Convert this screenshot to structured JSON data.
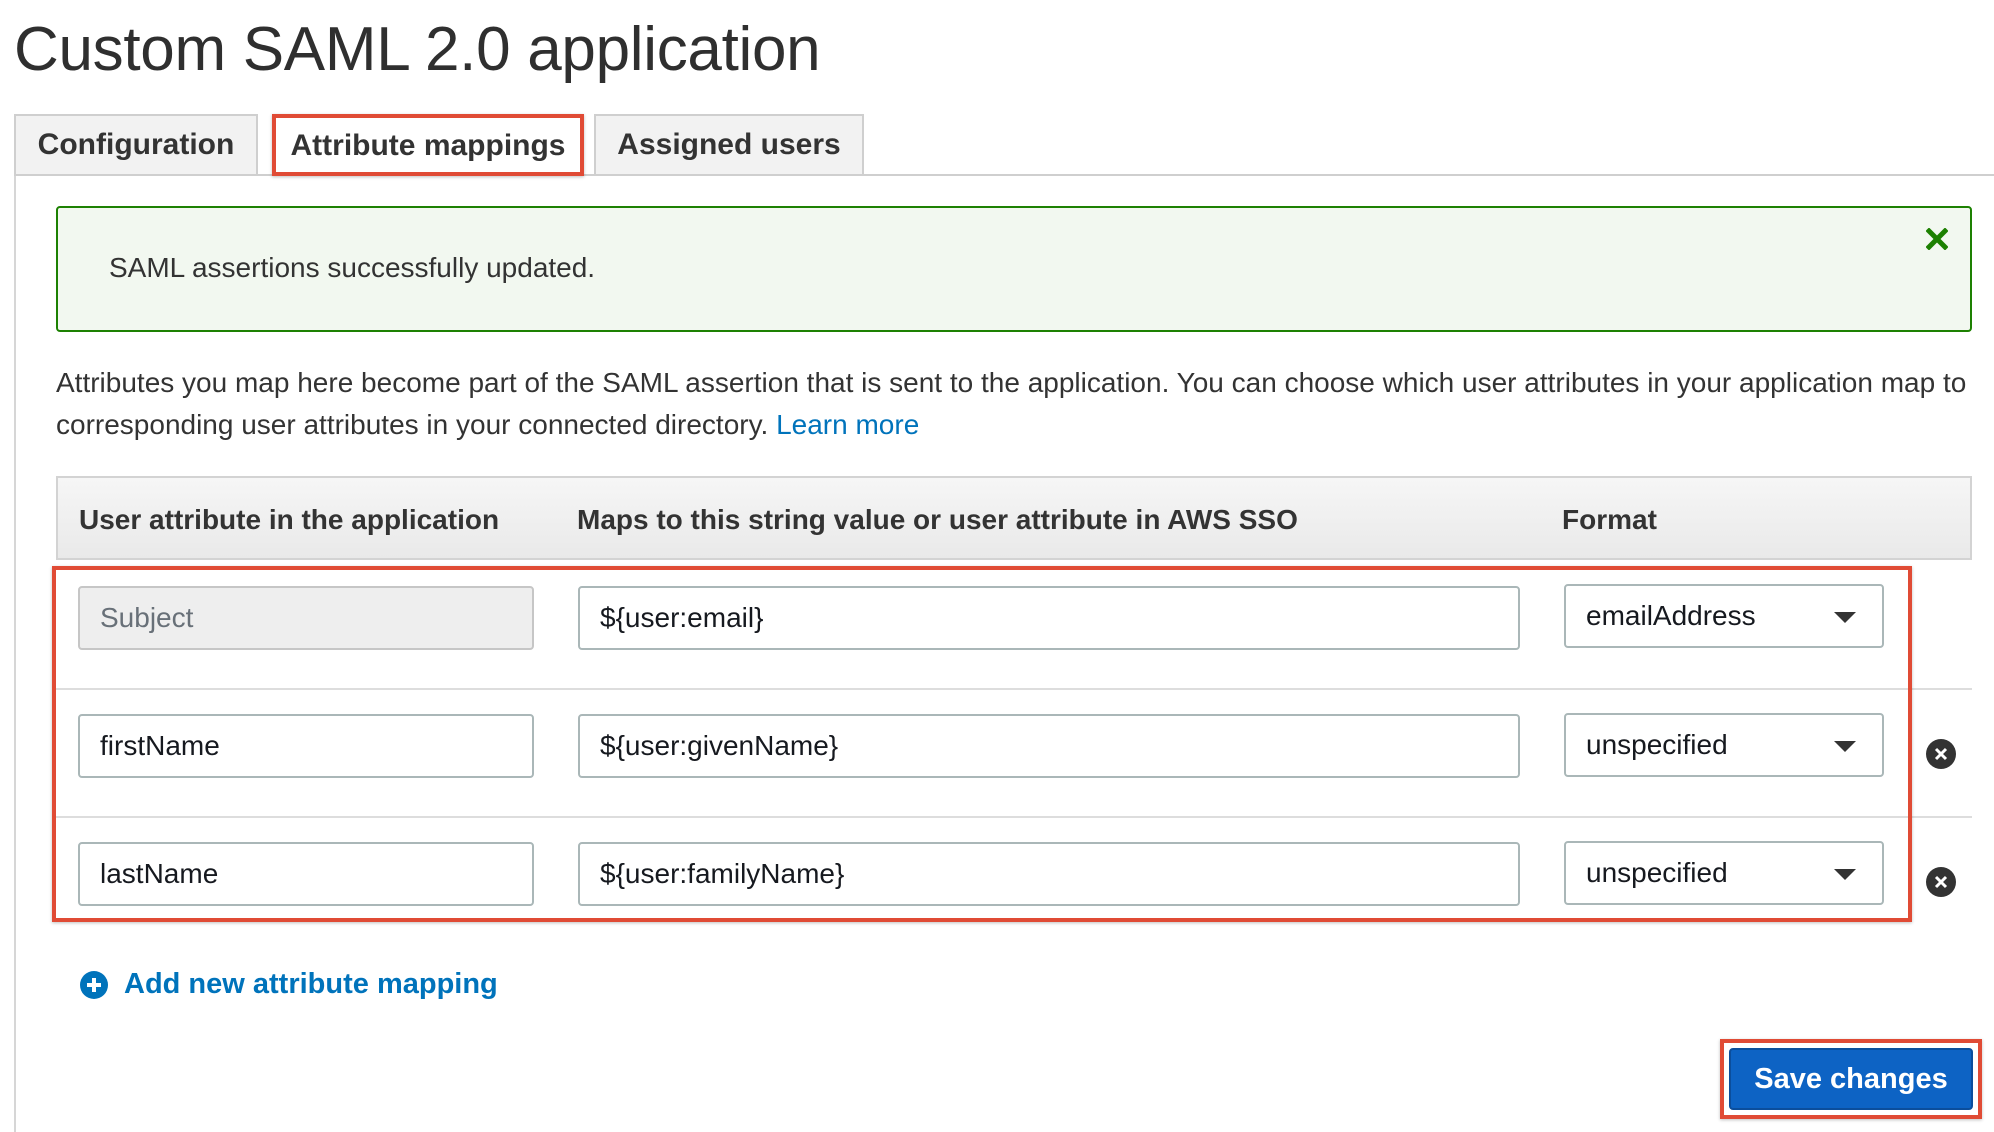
{
  "page": {
    "title": "Custom SAML 2.0 application"
  },
  "tabs": [
    {
      "label": "Configuration"
    },
    {
      "label": "Attribute mappings"
    },
    {
      "label": "Assigned users"
    }
  ],
  "alert": {
    "message": "SAML assertions successfully updated.",
    "close_icon": "close-x-icon",
    "color": "#1d8102"
  },
  "description": {
    "text": "Attributes you map here become part of the SAML assertion that is sent to the application. You can choose which user attributes in your application map to corresponding user attributes in your connected directory.",
    "link": "Learn more"
  },
  "table": {
    "headers": [
      "User attribute in the application",
      "Maps to this string value or user attribute in AWS SSO",
      "Format"
    ],
    "rows": [
      {
        "attribute": "Subject",
        "value": "${user:email}",
        "format": "emailAddress"
      },
      {
        "attribute": "firstName",
        "value": "${user:givenName}",
        "format": "unspecified"
      },
      {
        "attribute": "lastName",
        "value": "${user:familyName}",
        "format": "unspecified"
      }
    ]
  },
  "add_mapping": {
    "label": "Add new attribute mapping",
    "icon": "plus-circle-icon"
  },
  "save_button": {
    "label": "Save changes"
  },
  "colors": {
    "accent": "#0073bb",
    "button": "#0d63c4",
    "highlight": "#e04b35"
  }
}
